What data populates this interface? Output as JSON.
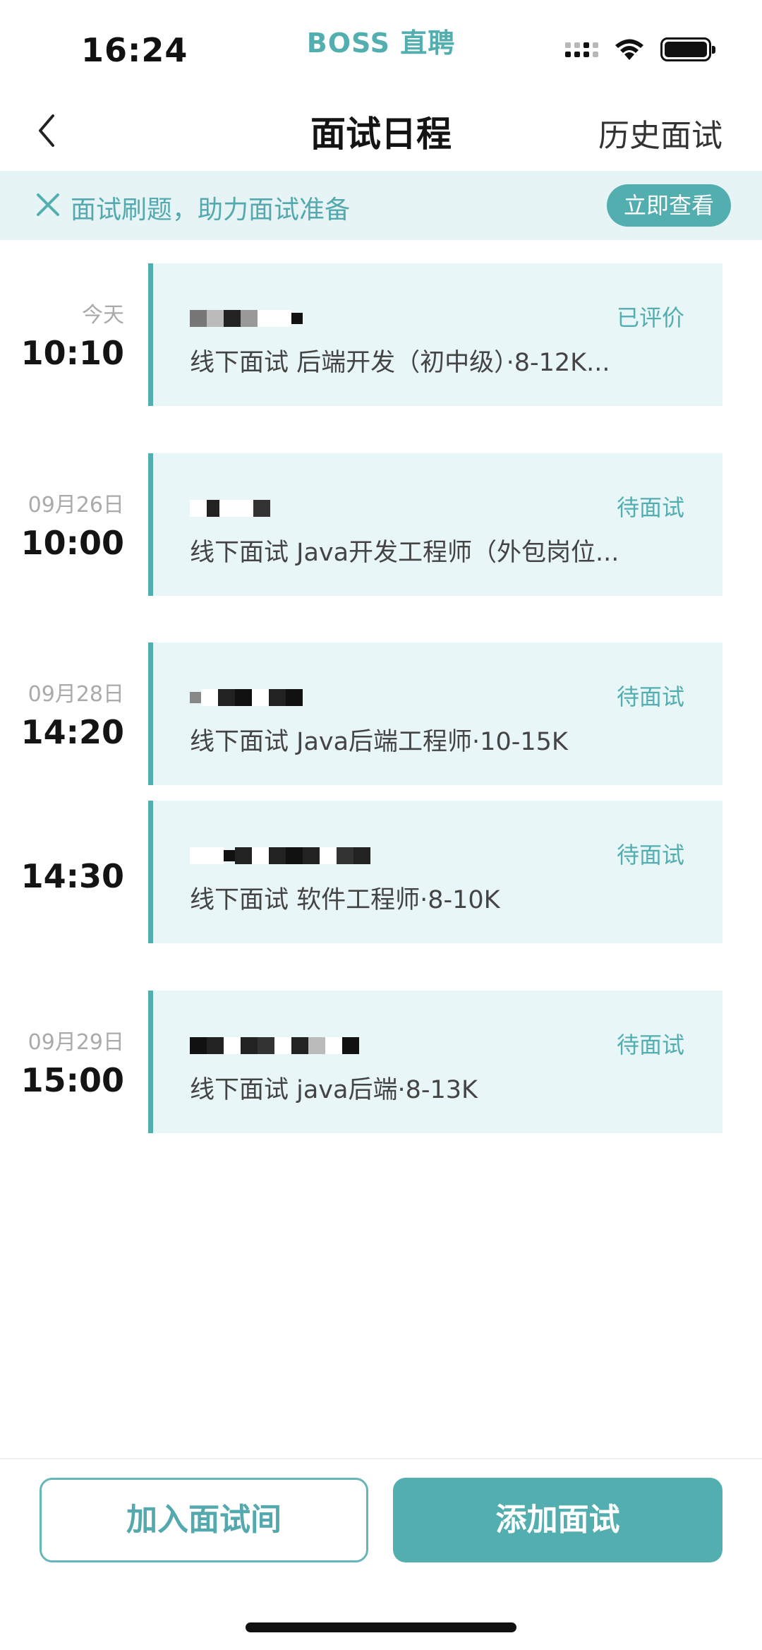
{
  "status_bar": {
    "time": "16:24",
    "app_brand": "BOSS 直聘"
  },
  "nav": {
    "title": "面试日程",
    "history_label": "历史面试"
  },
  "banner": {
    "text": "面试刷题，助力面试准备",
    "button_label": "立即查看"
  },
  "interviews": [
    {
      "day": "今天",
      "time": "10:10",
      "status": "已评价",
      "description": "线下面试 后端开发（初中级）·8-12K..."
    },
    {
      "day": "09月26日",
      "time": "10:00",
      "status": "待面试",
      "description": "线下面试 Java开发工程师（外包岗位..."
    },
    {
      "day": "09月28日",
      "time": "14:20",
      "status": "待面试",
      "description": "线下面试 Java后端工程师·10-15K"
    },
    {
      "day": "",
      "time": "14:30",
      "status": "待面试",
      "description": "线下面试 软件工程师·8-10K"
    },
    {
      "day": "09月29日",
      "time": "15:00",
      "status": "待面试",
      "description": "线下面试 java后端·8-13K"
    }
  ],
  "bottom": {
    "join_label": "加入面试间",
    "add_label": "添加面试"
  },
  "colors": {
    "accent": "#53aeb0",
    "card_bg": "#e9f6f7",
    "banner_bg": "#e6f4f6"
  }
}
